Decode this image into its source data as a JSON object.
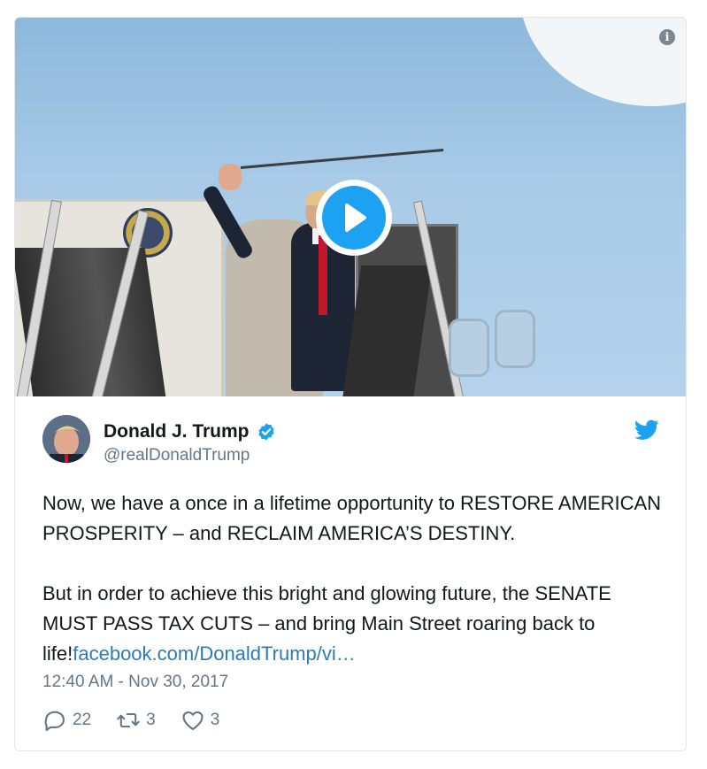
{
  "tweet": {
    "author": {
      "name": "Donald J. Trump",
      "handle": "@realDonaldTrump",
      "verified": true
    },
    "text_para1": "Now, we have a once in a lifetime opportunity to RESTORE AMERICAN PROSPERITY – and RECLAIM AMERICA’S DESTINY.",
    "text_para2": "But in order to achieve this bright and glowing future, the SENATE MUST PASS TAX CUTS – and bring Main Street roaring back to life!",
    "link_text": "facebook.com/DonaldTrump/vi…",
    "timestamp": "12:40 AM - Nov 30, 2017",
    "stats": {
      "replies": "22",
      "retweets": "3",
      "likes": "3"
    }
  },
  "media": {
    "type": "video",
    "info_icon": "i"
  },
  "colors": {
    "accent": "#1da1f2",
    "link": "#2b7bb9",
    "muted": "#657786",
    "border": "#e1e8ed"
  },
  "icons": {
    "play": "play-icon",
    "info": "info-icon",
    "verified": "verified-badge-icon",
    "bird": "twitter-bird-icon",
    "reply": "reply-icon",
    "retweet": "retweet-icon",
    "like": "heart-icon"
  }
}
